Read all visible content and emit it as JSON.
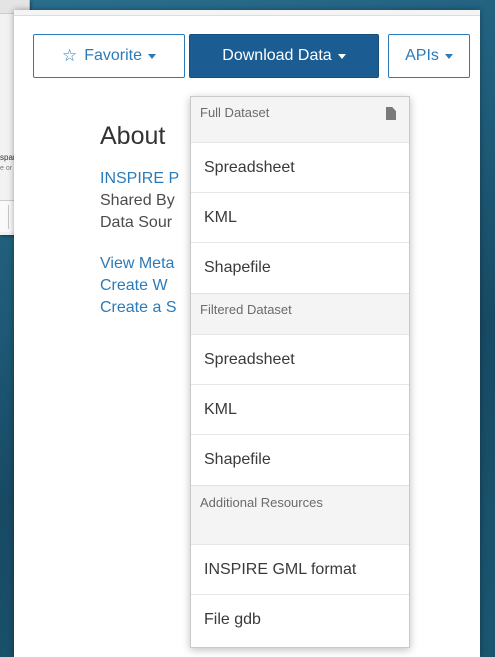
{
  "background_window": {
    "fragment_1": "spar",
    "fragment_2": "e or T"
  },
  "toolbar": {
    "favorite_label": "Favorite",
    "download_label": "Download Data",
    "apis_label": "APIs"
  },
  "about": {
    "title": "About",
    "link_1": "INSPIRE P",
    "shared_by": "Shared By",
    "data_source": "Data Sour",
    "link_view": "View Meta",
    "link_create_1": "Create W",
    "link_create_2": "Create a S"
  },
  "dropdown": {
    "full_dataset_header": "Full Dataset",
    "full_items": [
      "Spreadsheet",
      "KML",
      "Shapefile"
    ],
    "filtered_dataset_header": "Filtered Dataset",
    "filtered_items": [
      "Spreadsheet",
      "KML",
      "Shapefile"
    ],
    "additional_header": "Additional Resources",
    "additional_items": [
      "INSPIRE GML format",
      "File gdb"
    ]
  },
  "icons": {
    "favorite": "star-outline-icon",
    "full_dataset": "document-icon"
  },
  "colors": {
    "primary_button": "#1b5c93",
    "link": "#2b7bba",
    "section_header_bg": "#f4f4f4"
  }
}
